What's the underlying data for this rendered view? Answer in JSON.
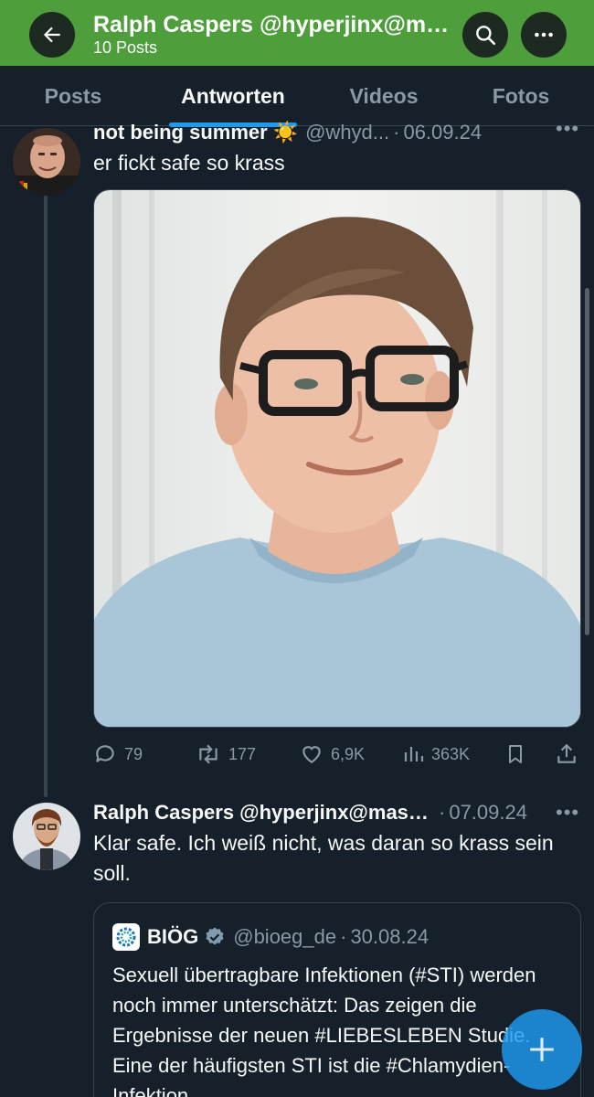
{
  "header": {
    "title": "Ralph Caspers @hyperjinx@mastodon.social",
    "subtitle": "10 Posts",
    "bg_color": "#4e9e3c",
    "icons": [
      "back-arrow-icon",
      "search-icon",
      "more-icon"
    ]
  },
  "tabs": [
    {
      "label": "Posts",
      "active": false
    },
    {
      "label": "Antworten",
      "active": true
    },
    {
      "label": "Videos",
      "active": false
    },
    {
      "label": "Fotos",
      "active": false
    }
  ],
  "tweet1": {
    "name": "not being summer",
    "emoji": "☀️",
    "handle": "@whyd...",
    "date": "06.09.24",
    "text": "er fickt safe so krass",
    "photo_icon": "person-photo",
    "actions": {
      "replies": "79",
      "reposts": "177",
      "likes": "6,9K",
      "views": "363K"
    }
  },
  "tweet2": {
    "name": "Ralph Caspers @hyperjinx@mastodon.social",
    "date": "07.09.24",
    "text": "Klar safe. Ich weiß nicht, was daran so krass sein soll.",
    "quote": {
      "name": "BIÖG",
      "handle": "@bioeg_de",
      "date": "30.08.24",
      "text": "Sexuell übertragbare Infektionen (#STI) werden noch immer unterschätzt: Das zeigen die Ergebnisse der neuen #LIEBESLEBEN Studie. Eine der häufigsten STI ist die #Chlamydien-Infektion"
    }
  },
  "separator": "·",
  "more_glyph": "•••",
  "accent_color": "#1d9bf0"
}
